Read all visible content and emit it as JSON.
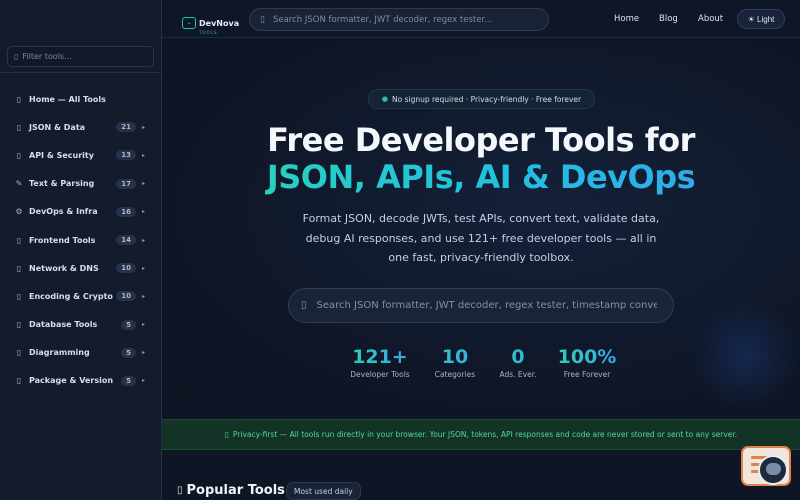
{
  "sidebar": {
    "search_placeholder": "Filter tools...",
    "items": [
      {
        "icon": "doc-icon",
        "label": "Home — All Tools",
        "count": "",
        "arrow": ""
      },
      {
        "icon": "doc-icon",
        "label": "JSON & Data",
        "count": "21",
        "arrow": "▸"
      },
      {
        "icon": "doc-icon",
        "label": "API & Security",
        "count": "13",
        "arrow": "▸"
      },
      {
        "icon": "pen-icon",
        "label": "Text & Parsing",
        "count": "17",
        "arrow": "▸"
      },
      {
        "icon": "gear-icon",
        "label": "DevOps & Infra",
        "count": "16",
        "arrow": "▸"
      },
      {
        "icon": "doc-icon",
        "label": "Frontend Tools",
        "count": "14",
        "arrow": "▸"
      },
      {
        "icon": "doc-icon",
        "label": "Network & DNS",
        "count": "10",
        "arrow": "▸"
      },
      {
        "icon": "doc-icon",
        "label": "Encoding & Crypto",
        "count": "10",
        "arrow": "▸"
      },
      {
        "icon": "doc-icon",
        "label": "Database Tools",
        "count": "5",
        "arrow": "▸"
      },
      {
        "icon": "doc-icon",
        "label": "Diagramming",
        "count": "5",
        "arrow": "▸"
      },
      {
        "icon": "doc-icon",
        "label": "Package & Version",
        "count": "5",
        "arrow": "▸"
      }
    ]
  },
  "nav": {
    "logo_text": "DevNova",
    "logo_sub": "TOOLS",
    "search_placeholder": "Search JSON formatter, JWT decoder, regex tester...",
    "links": [
      "Home",
      "Blog",
      "About"
    ],
    "theme_label": "☀ Light"
  },
  "hero": {
    "pill": "No signup required · Privacy-friendly · Free forever",
    "title_line1": "Free Developer Tools for",
    "title_line2": "JSON, APIs, AI & DevOps",
    "subtitle": "Format JSON, decode JWTs, test APIs, convert text, validate data, debug AI responses, and use 121+ free developer tools — all in one fast, privacy-friendly toolbox.",
    "search_placeholder": "Search JSON formatter, JWT decoder, regex tester, timestamp converter...",
    "stats": [
      {
        "value": "121+",
        "label": "Developer Tools"
      },
      {
        "value": "10",
        "label": "Categories"
      },
      {
        "value": "0",
        "label": "Ads. Ever."
      },
      {
        "value": "100%",
        "label": "Free Forever"
      }
    ]
  },
  "banner": {
    "text": "Privacy-first — All tools run directly in your browser. Your JSON, tokens, API responses and code are never stored or sent to any server."
  },
  "popular": {
    "title": "Popular Tools",
    "badge": "Most used daily"
  },
  "colors": {
    "accent_teal": "#22c5a8",
    "accent_blue": "#3aa0f0",
    "banner_green": "#56d69c",
    "background": "#0e1524"
  }
}
